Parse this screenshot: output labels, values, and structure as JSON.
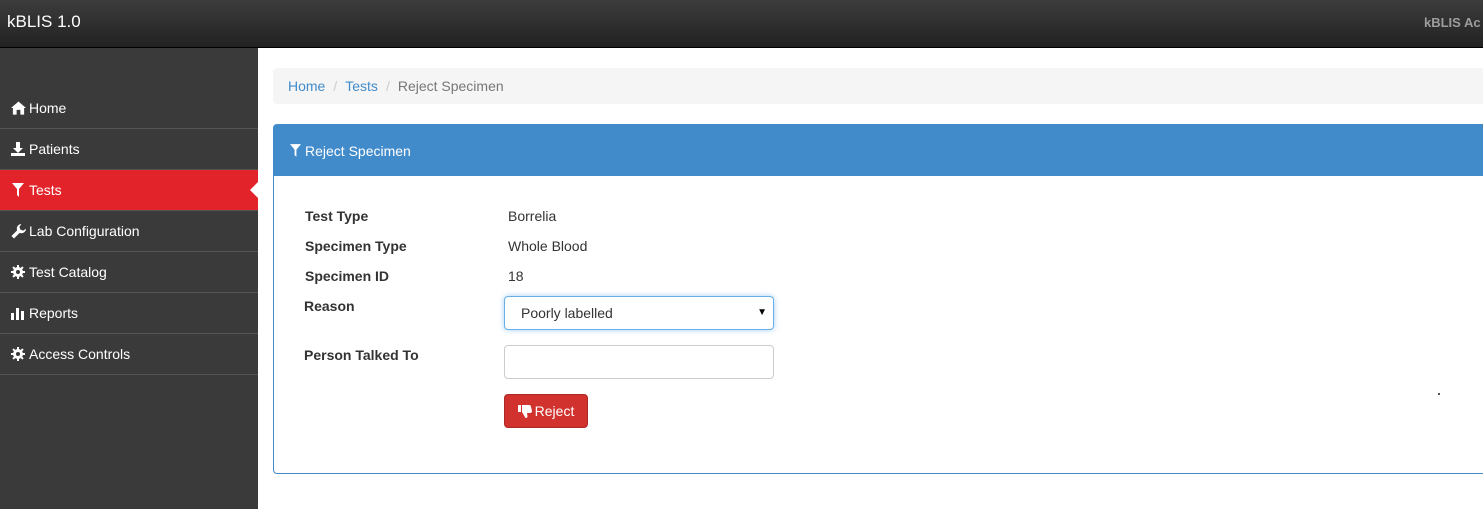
{
  "app": {
    "brand": "kBLIS 1.0",
    "topbar_right": "kBLIS Ac"
  },
  "sidebar": {
    "items": [
      {
        "label": "Home",
        "icon": "home-icon",
        "active": false
      },
      {
        "label": "Patients",
        "icon": "download-icon",
        "active": false
      },
      {
        "label": "Tests",
        "icon": "filter-icon",
        "active": true
      },
      {
        "label": "Lab Configuration",
        "icon": "wrench-icon",
        "active": false
      },
      {
        "label": "Test Catalog",
        "icon": "cog-icon",
        "active": false
      },
      {
        "label": "Reports",
        "icon": "bar-chart-icon",
        "active": false
      },
      {
        "label": "Access Controls",
        "icon": "cog-icon",
        "active": false
      }
    ],
    "active_color": "#e3232a"
  },
  "breadcrumb": {
    "home": "Home",
    "tests": "Tests",
    "current": "Reject Specimen"
  },
  "panel": {
    "title": "Reject Specimen",
    "title_icon": "filter-icon",
    "header_color": "#428bca",
    "fields": {
      "test_type": {
        "label": "Test Type",
        "value": "Borrelia"
      },
      "specimen_type": {
        "label": "Specimen Type",
        "value": "Whole Blood"
      },
      "specimen_id": {
        "label": "Specimen ID",
        "value": "18"
      },
      "reason": {
        "label": "Reason",
        "selected": "Poorly labelled"
      },
      "person_talked_to": {
        "label": "Person Talked To",
        "value": "",
        "placeholder": ""
      }
    },
    "reject_button": {
      "label": "Reject",
      "icon": "thumbs-down-icon",
      "color": "#d2322d"
    }
  }
}
